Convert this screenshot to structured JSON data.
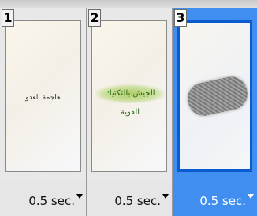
{
  "frames": [
    {
      "number": "1",
      "delay": "0.5 sec.",
      "content": "هاجمة العدو",
      "selected": false
    },
    {
      "number": "2",
      "delay": "0.5 sec.",
      "content": "الجيش بالتكتيك القوية",
      "selected": false
    },
    {
      "number": "3",
      "delay": "0.5 sec.",
      "content": "",
      "selected": true
    }
  ],
  "colors": {
    "selected_bg": "#3f8ef0",
    "selected_border": "#0a5bd0",
    "frame_bg": "#e8e8e8"
  },
  "icons": {
    "delay_menu": "chevron-down-icon"
  }
}
